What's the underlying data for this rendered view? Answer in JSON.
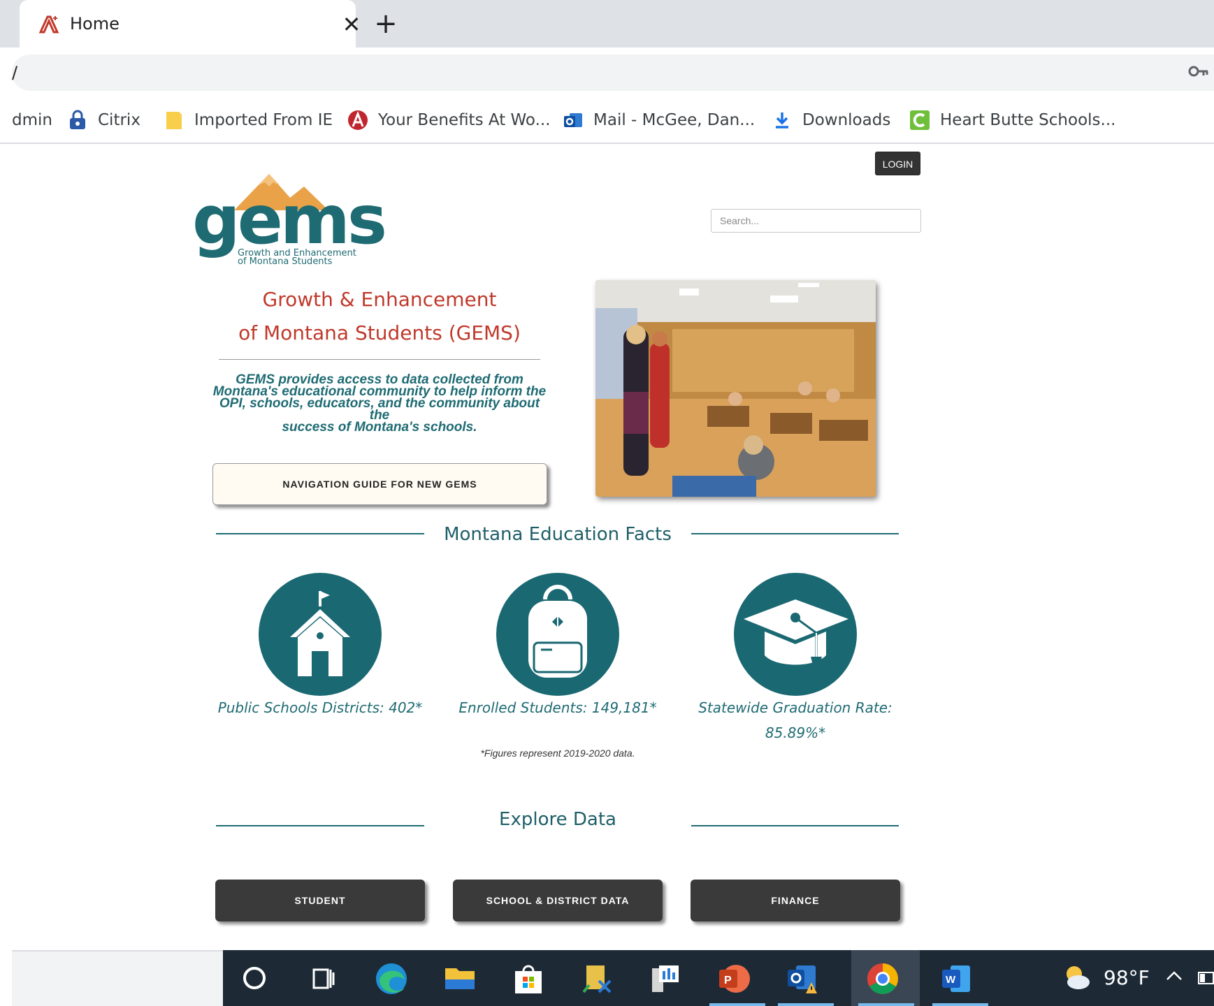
{
  "browser": {
    "tab": {
      "title": "Home",
      "icon": "acrobat-icon",
      "close_glyph": "✕"
    },
    "new_tab_glyph": "+",
    "address_fragment": "/",
    "bookmarks": [
      {
        "label": "dmin",
        "icon": "none"
      },
      {
        "label": "Citrix",
        "icon": "citrix-lock-icon"
      },
      {
        "label": "Imported From IE",
        "icon": "folder-icon"
      },
      {
        "label": "Your Benefits At Wo...",
        "icon": "benefits-icon"
      },
      {
        "label": "Mail - McGee, Dan...",
        "icon": "outlook-icon"
      },
      {
        "label": "Downloads",
        "icon": "download-icon"
      },
      {
        "label": "Heart Butte Schools...",
        "icon": "heart-butte-icon"
      }
    ]
  },
  "page": {
    "login_label": "LOGIN",
    "search_placeholder": "Search...",
    "logo": {
      "word": "gems",
      "tagline_1": "Growth and Enhancement",
      "tagline_2": "of Montana Students"
    },
    "hero_title_1": "Growth & Enhancement",
    "hero_title_2": "of Montana Students (GEMS)",
    "hero_desc_1": "GEMS provides access to data collected from",
    "hero_desc_2": "Montana's educational community to help inform the",
    "hero_desc_3": "OPI, schools, educators, and the community about the",
    "hero_desc_4": "success of Montana's schools.",
    "nav_guide_label": "NAVIGATION GUIDE FOR NEW GEMS",
    "facts_heading": "Montana Education Facts",
    "facts": [
      {
        "label": "Public Schools Districts: 402*",
        "icon": "schoolhouse-icon"
      },
      {
        "label": "Enrolled Students: 149,181*",
        "icon": "backpack-icon"
      },
      {
        "label_1": "Statewide Graduation Rate:",
        "label_2": "85.89%*",
        "icon": "graduation-cap-icon"
      }
    ],
    "footnote": "*Figures represent 2019-2020 data.",
    "explore_heading": "Explore Data",
    "explore_buttons": [
      "STUDENT",
      "SCHOOL & DISTRICT DATA",
      "FINANCE"
    ]
  },
  "taskbar": {
    "items": [
      "cortana-icon",
      "task-view-icon",
      "edge-icon",
      "file-explorer-icon",
      "store-icon",
      "app-icon",
      "server-manager-icon",
      "powerpoint-icon",
      "outlook-icon",
      "chrome-icon",
      "word-icon"
    ],
    "weather_temp": "98°F",
    "accent": "#76b9ed"
  },
  "colors": {
    "brand_teal": "#1f6b73",
    "title_red": "#c0392b",
    "button_dark": "#3a3a3a"
  }
}
